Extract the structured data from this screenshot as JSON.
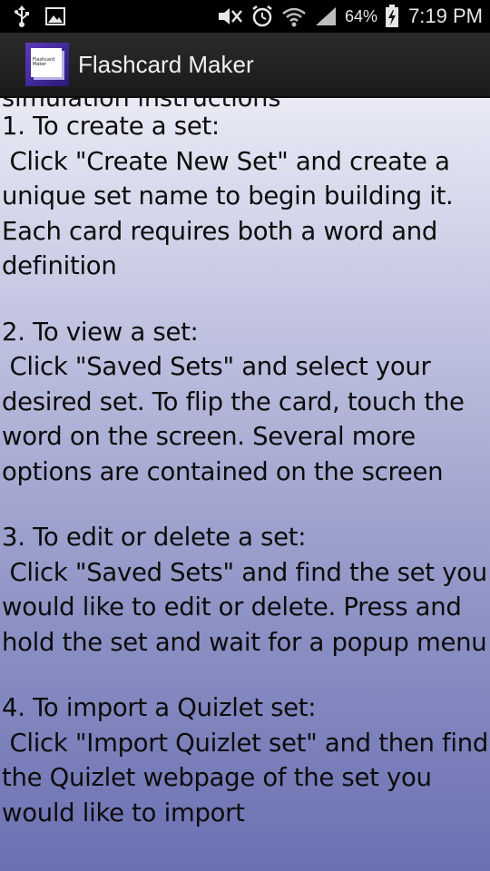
{
  "status_bar": {
    "icons": [
      "usb-icon",
      "image-icon",
      "mute-icon",
      "alarm-icon",
      "wifi-icon",
      "signal-icon",
      "battery-charging-icon"
    ],
    "battery_percent": "64%",
    "time": "7:19 PM"
  },
  "action_bar": {
    "title": "Flashcard Maker"
  },
  "content": {
    "partial_line": "simulation instructions",
    "steps": [
      {
        "heading": "1. To create a set:",
        "body": "Click \"Create New Set\" and create a unique set name to begin building it. Each card requires both a word and definition"
      },
      {
        "heading": "2. To view a set:",
        "body": "Click \"Saved Sets\" and select your desired set. To flip the card, touch the word on the screen. Several more options are contained on the screen"
      },
      {
        "heading": "3. To edit or delete a set:",
        "body": "Click \"Saved Sets\" and find the set you would like to edit or delete. Press and hold the set and wait for a popup menu"
      },
      {
        "heading": "4. To import a Quizlet set:",
        "body": "Click \"Import Quizlet set\" and then find the Quizlet webpage of the set you would like to import"
      }
    ]
  },
  "colors": {
    "status_bar_bg": "#000000",
    "action_bar_bg": "#222222",
    "content_top": "#e9eaf5",
    "content_bottom": "#6b70b2",
    "text": "#0c0c0c"
  }
}
